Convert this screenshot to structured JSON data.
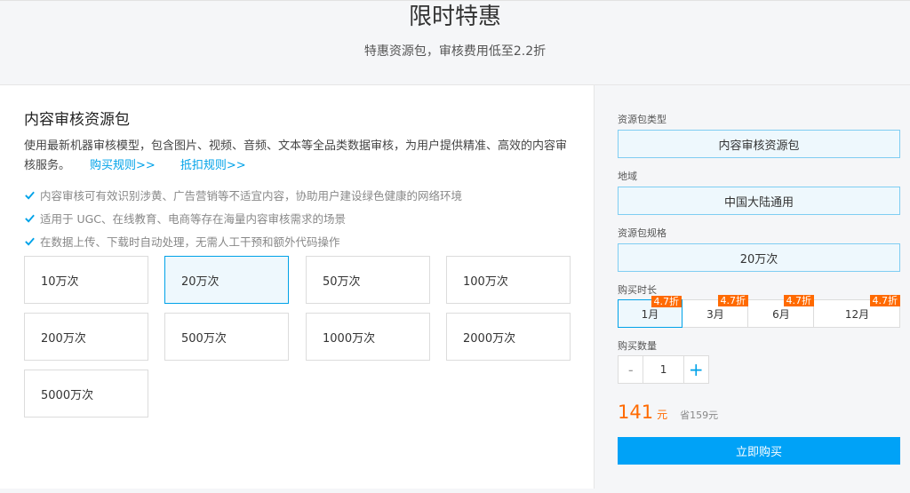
{
  "header": {
    "title": "限时特惠",
    "subtitle": "特惠资源包，审核费用低至2.2折"
  },
  "product": {
    "title": "内容审核资源包",
    "description": "使用最新机器审核模型，包含图片、视频、音频、文本等全品类数据审核，为用户提供精准、高效的内容审核服务。",
    "links": {
      "purchase_rules": "购买规则>>",
      "deduction_rules": "抵扣规则>>"
    },
    "features": [
      "内容审核可有效识别涉黄、广告营销等不适宜内容，协助用户建设绿色健康的网络环境",
      "适用于 UGC、在线教育、电商等存在海量内容审核需求的场景",
      "在数据上传、下载时自动处理，无需人工干预和额外代码操作"
    ],
    "specs": [
      "10万次",
      "20万次",
      "50万次",
      "100万次",
      "200万次",
      "500万次",
      "1000万次",
      "2000万次",
      "5000万次"
    ],
    "selected_spec": "20万次"
  },
  "order": {
    "package_type_label": "资源包类型",
    "package_type_value": "内容审核资源包",
    "region_label": "地域",
    "region_value": "中国大陆通用",
    "spec_label": "资源包规格",
    "spec_value": "20万次",
    "duration_label": "购买时长",
    "durations": [
      {
        "label": "1月",
        "badge": "4.7折"
      },
      {
        "label": "3月",
        "badge": "4.7折"
      },
      {
        "label": "6月",
        "badge": "4.7折"
      },
      {
        "label": "12月",
        "badge": "4.7折"
      }
    ],
    "selected_duration": "1月",
    "quantity_label": "购买数量",
    "quantity_minus": "-",
    "quantity_value": "1",
    "quantity_plus": "+",
    "price_amount": "141",
    "price_unit": "元",
    "price_save": "省159元",
    "buy_button": "立即购买"
  },
  "colors": {
    "accent": "#00a2e8",
    "price": "#ff6a00",
    "badge": "#ff6a00"
  }
}
